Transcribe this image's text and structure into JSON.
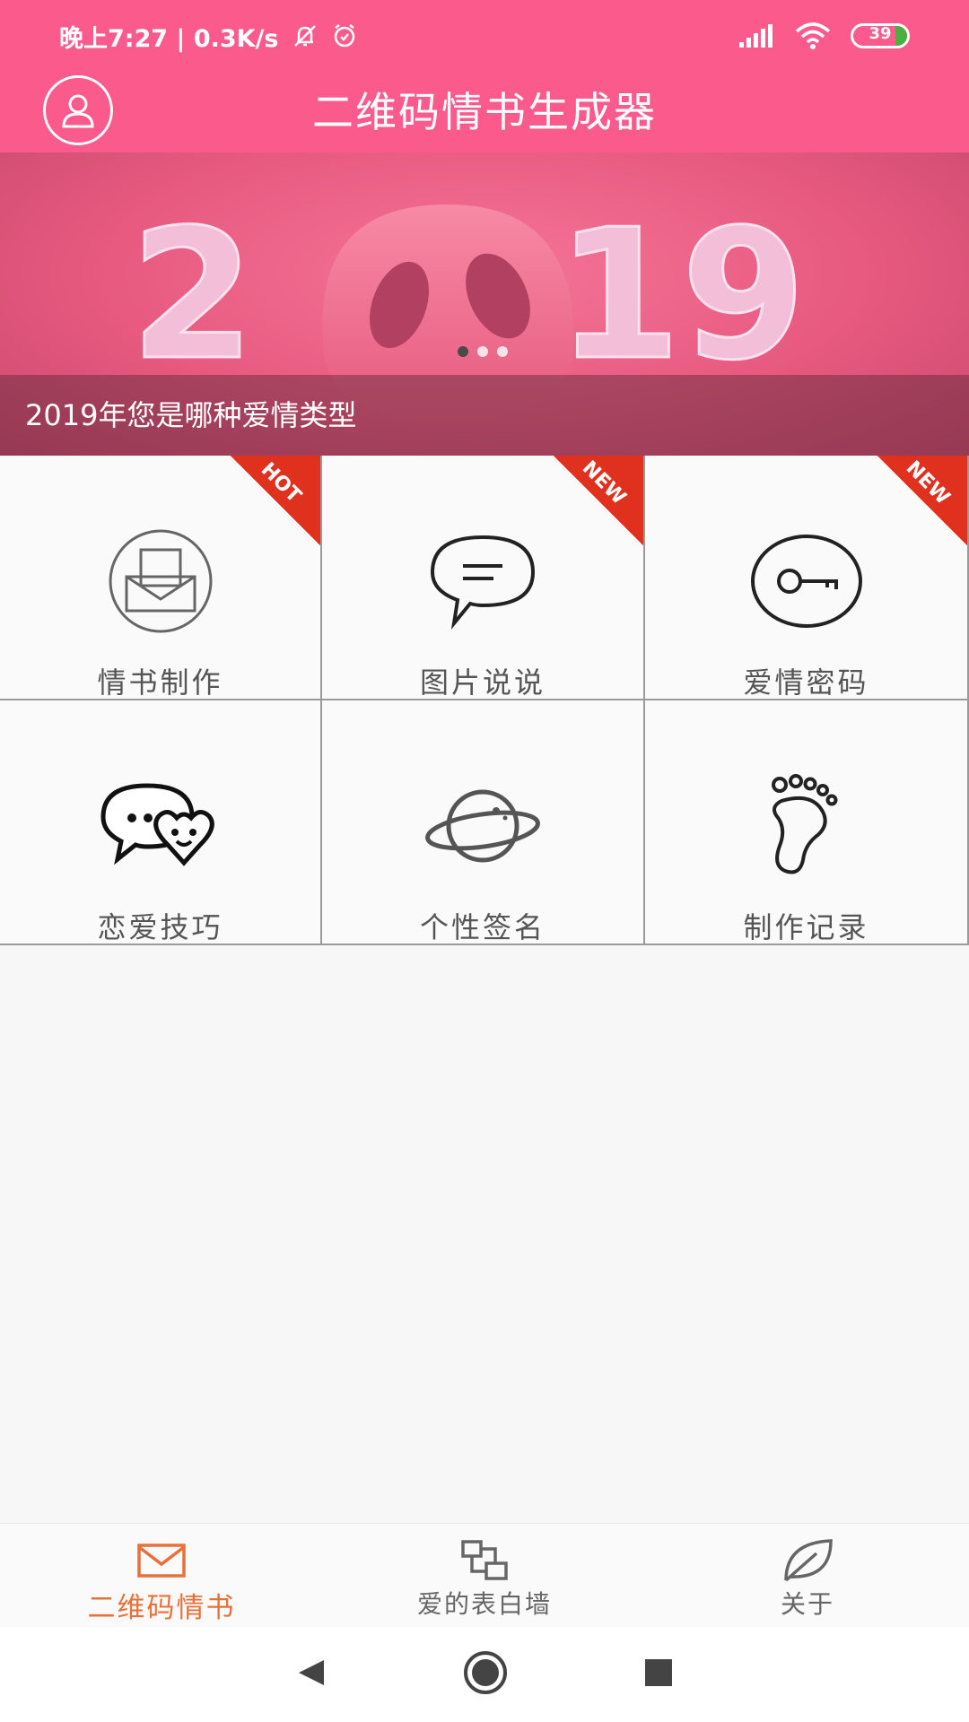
{
  "status_bar": {
    "time_speed": "晚上7:27 | 0.3K/s",
    "battery": "39",
    "icons": [
      "mute-bell-icon",
      "alarm-icon",
      "signal-icon",
      "wifi-icon",
      "battery-icon"
    ]
  },
  "header": {
    "title": "二维码情书生成器",
    "left_icon": "user-icon"
  },
  "banner": {
    "caption": "2019年您是哪种爱情类型",
    "art_text": "2019",
    "dot_count": 3,
    "active_dot": 0
  },
  "grid": {
    "items": [
      {
        "label": "情书制作",
        "icon": "envelope-icon",
        "ribbon": "HOT"
      },
      {
        "label": "图片说说",
        "icon": "speech-bubble-icon",
        "ribbon": "NEW"
      },
      {
        "label": "爱情密码",
        "icon": "key-icon",
        "ribbon": "NEW"
      },
      {
        "label": "恋爱技巧",
        "icon": "chat-heart-icon",
        "ribbon": ""
      },
      {
        "label": "个性签名",
        "icon": "planet-icon",
        "ribbon": ""
      },
      {
        "label": "制作记录",
        "icon": "footprint-icon",
        "ribbon": ""
      }
    ]
  },
  "bottom_nav": {
    "items": [
      {
        "label": "二维码情书",
        "icon": "mail-icon",
        "active": true
      },
      {
        "label": "爱的表白墙",
        "icon": "wall-icon",
        "active": false
      },
      {
        "label": "关于",
        "icon": "leaf-icon",
        "active": false
      }
    ]
  },
  "colors": {
    "brand": "#fb5a8d",
    "active_tab": "#e8703b",
    "ribbon": "#e0301e"
  }
}
